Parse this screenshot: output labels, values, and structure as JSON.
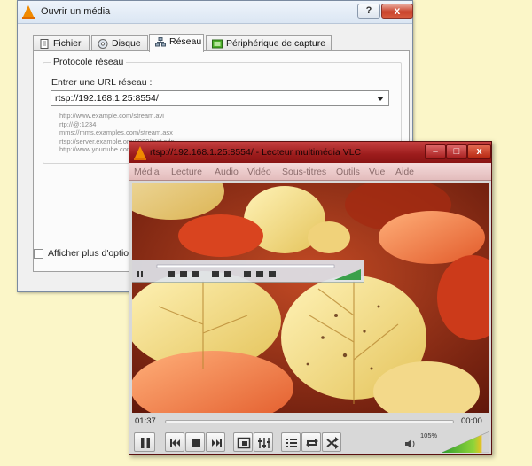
{
  "dialog": {
    "title": "Ouvrir un média",
    "help_label": "?",
    "close_label": "x",
    "tabs": [
      {
        "label": "Fichier",
        "icon": "file-icon"
      },
      {
        "label": "Disque",
        "icon": "disc-icon"
      },
      {
        "label": "Réseau",
        "icon": "network-icon",
        "active": true
      },
      {
        "label": "Périphérique de capture",
        "icon": "capture-device-icon"
      }
    ],
    "group_title": "Protocole réseau",
    "url_label": "Entrer une URL réseau :",
    "url_value": "rtsp://192.168.1.25:8554/",
    "examples": [
      "http://www.example.com/stream.avi",
      "rtp://@:1234",
      "mms://mms.examples.com/stream.asx",
      "rtsp://server.example.org:8080/test.sdp",
      "http://www.yourtube.com/watch?v=gg64x"
    ],
    "more_options_label": "Afficher plus d'options"
  },
  "player": {
    "title": "rtsp://192.168.1.25:8554/ - Lecteur multimédia VLC",
    "minimize_label": "–",
    "maximize_label": "□",
    "close_label": "x",
    "menu": [
      "Média",
      "Lecture",
      "Audio",
      "Vidéo",
      "Sous-titres",
      "Outils",
      "Vue",
      "Aide"
    ],
    "elapsed": "01:37",
    "remaining": "00:00",
    "volume_label": "105%",
    "volume_level": 105,
    "accent_color": "#f08a00",
    "titlebar_color": "#a52020"
  }
}
